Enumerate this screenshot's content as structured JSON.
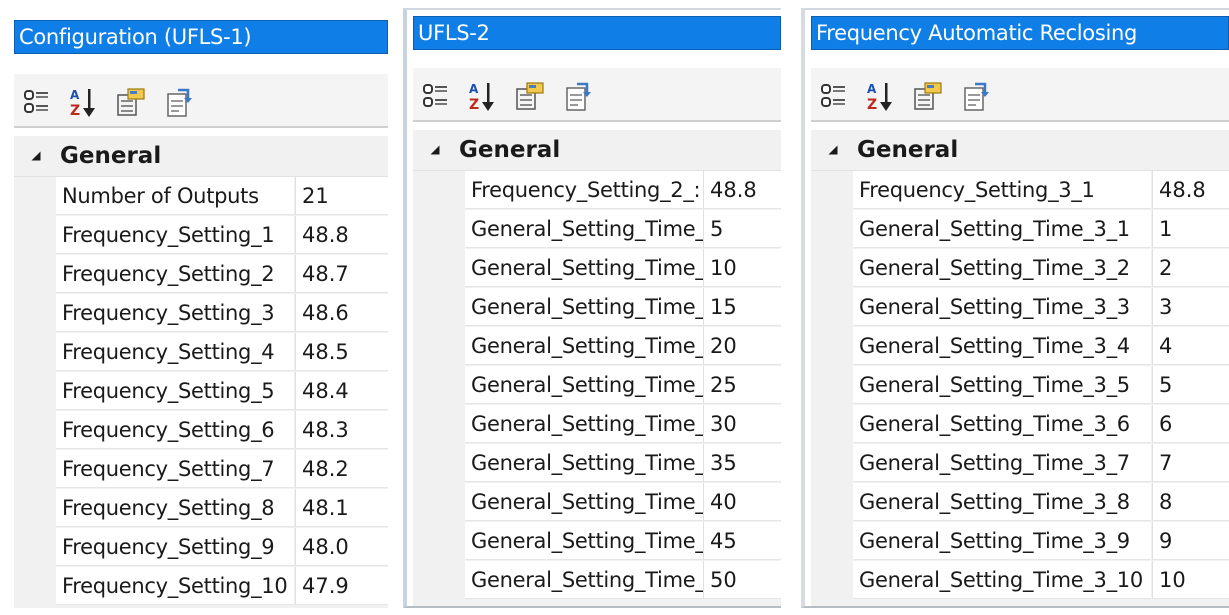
{
  "panels": [
    {
      "title": "Configuration (UFLS-1)",
      "category": "General",
      "rows": [
        {
          "name": "Number of Outputs",
          "value": "21"
        },
        {
          "name": "Frequency_Setting_1",
          "value": "48.8"
        },
        {
          "name": "Frequency_Setting_2",
          "value": "48.7"
        },
        {
          "name": "Frequency_Setting_3",
          "value": "48.6"
        },
        {
          "name": "Frequency_Setting_4",
          "value": "48.5"
        },
        {
          "name": "Frequency_Setting_5",
          "value": "48.4"
        },
        {
          "name": "Frequency_Setting_6",
          "value": "48.3"
        },
        {
          "name": "Frequency_Setting_7",
          "value": "48.2"
        },
        {
          "name": "Frequency_Setting_8",
          "value": "48.1"
        },
        {
          "name": "Frequency_Setting_9",
          "value": "48.0"
        },
        {
          "name": "Frequency_Setting_10",
          "value": "47.9"
        }
      ]
    },
    {
      "title": "UFLS-2",
      "category": "General",
      "rows": [
        {
          "name": "Frequency_Setting_2_:",
          "value": "48.8"
        },
        {
          "name": "General_Setting_Time_",
          "value": "5"
        },
        {
          "name": "General_Setting_Time_",
          "value": "10"
        },
        {
          "name": "General_Setting_Time_",
          "value": "15"
        },
        {
          "name": "General_Setting_Time_",
          "value": "20"
        },
        {
          "name": "General_Setting_Time_",
          "value": "25"
        },
        {
          "name": "General_Setting_Time_",
          "value": "30"
        },
        {
          "name": "General_Setting_Time_",
          "value": "35"
        },
        {
          "name": "General_Setting_Time_",
          "value": "40"
        },
        {
          "name": "General_Setting_Time_",
          "value": "45"
        },
        {
          "name": "General_Setting_Time_",
          "value": "50"
        }
      ]
    },
    {
      "title": "Frequency Automatic Reclosing",
      "category": "General",
      "rows": [
        {
          "name": "Frequency_Setting_3_1",
          "value": "48.8"
        },
        {
          "name": "General_Setting_Time_3_1",
          "value": "1"
        },
        {
          "name": "General_Setting_Time_3_2",
          "value": "2"
        },
        {
          "name": "General_Setting_Time_3_3",
          "value": "3"
        },
        {
          "name": "General_Setting_Time_3_4",
          "value": "4"
        },
        {
          "name": "General_Setting_Time_3_5",
          "value": "5"
        },
        {
          "name": "General_Setting_Time_3_6",
          "value": "6"
        },
        {
          "name": "General_Setting_Time_3_7",
          "value": "7"
        },
        {
          "name": "General_Setting_Time_3_8",
          "value": "8"
        },
        {
          "name": "General_Setting_Time_3_9",
          "value": "9"
        },
        {
          "name": "General_Setting_Time_3_10",
          "value": "10"
        }
      ]
    }
  ],
  "toolbar_icons": [
    "categorized-icon",
    "alphabetical-sort-icon",
    "property-pages-icon",
    "export-icon"
  ]
}
